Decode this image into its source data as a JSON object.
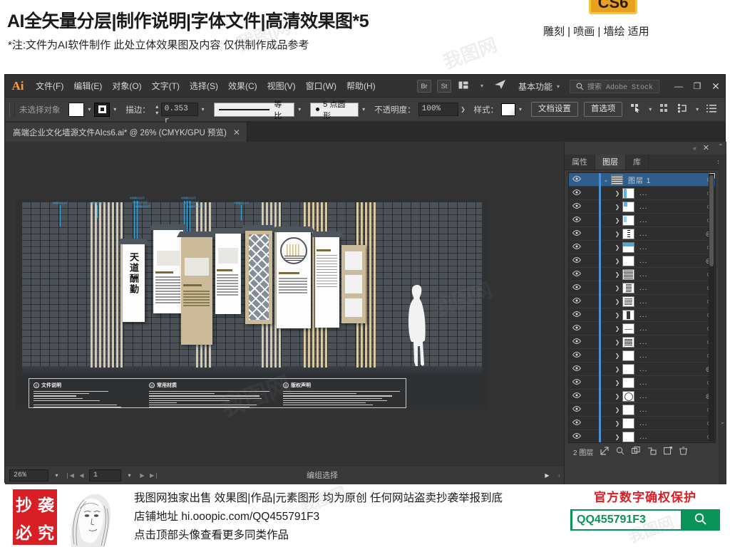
{
  "promo": {
    "title": "AI全矢量分层|制作说明|字体文件|高清效果图*5",
    "subtitle": "*注:文件为AI软件制作 此处立体效果图及内容 仅供制作成品参考",
    "right_text": "雕刻 | 喷画 | 墙绘 适用",
    "badge": "CS6",
    "badge_bg": "#e8a020",
    "badge_border": "#f5c53a"
  },
  "app": {
    "logo": "Ai",
    "menus": [
      "文件(F)",
      "编辑(E)",
      "对象(O)",
      "文字(T)",
      "选择(S)",
      "效果(C)",
      "视图(V)",
      "窗口(W)",
      "帮助(H)"
    ],
    "bridge_button": "Br",
    "stock_button": "St",
    "workspace": "基本功能",
    "stock_search_placeholder": "搜索 Adobe Stock",
    "window_buttons": {
      "minimize": "—",
      "maximize": "❐",
      "close": "✕"
    }
  },
  "control_bar": {
    "selection_status": "未选择对象",
    "stroke_label": "描边：",
    "stroke_weight": "0.353 r",
    "profile_label": "等比",
    "brush_label": "5 点圆形",
    "opacity_label": "不透明度：",
    "opacity_value": "100%",
    "style_label": "样式：",
    "doc_setup_button": "文档设置",
    "preferences_button": "首选项"
  },
  "document_tab": {
    "title": "高端企业文化墙源文件AIcs6.ai* @ 26% (CMYK/GPU 预览)",
    "close_glyph": "✕"
  },
  "status_bar": {
    "zoom": "26%",
    "page": "1",
    "tool": "编组选择",
    "first_glyph": "❘◀",
    "prev_glyph": "◀",
    "next_glyph": "▶",
    "last_glyph": "▶❘",
    "play_glyph": "▶",
    "expand_glyph": "‹"
  },
  "panel_dock": {
    "collapse_glyph": "«",
    "close_glyph": "✕",
    "tabs": [
      {
        "label": "属性",
        "active": false
      },
      {
        "label": "图层",
        "active": true
      },
      {
        "label": "库",
        "active": false
      }
    ],
    "menu_glyph": "≡",
    "footer": {
      "count_label": "2 图层",
      "icons": [
        "locate-icon",
        "search-icon",
        "new-sublayer-icon",
        "release-icon",
        "new-layer-icon",
        "trash-icon"
      ]
    },
    "layers": [
      {
        "name": "图层 1",
        "selected": true,
        "expanded": true,
        "thumb": "wall",
        "target": "○"
      },
      {
        "name": "...",
        "selected": false,
        "expanded": false,
        "thumb": "panel1",
        "target": "○"
      },
      {
        "name": "...",
        "selected": false,
        "expanded": false,
        "thumb": "panel2",
        "target": "○"
      },
      {
        "name": "...",
        "selected": false,
        "expanded": false,
        "thumb": "panel3",
        "target": "○"
      },
      {
        "name": "...",
        "selected": false,
        "expanded": false,
        "thumb": "calli",
        "target": "◎"
      },
      {
        "name": "...",
        "selected": false,
        "expanded": false,
        "thumb": "panel4",
        "target": "○"
      },
      {
        "name": "...",
        "selected": false,
        "expanded": false,
        "thumb": "blank",
        "target": "◎"
      },
      {
        "name": "...",
        "selected": false,
        "expanded": false,
        "thumb": "text1",
        "target": "○"
      },
      {
        "name": "...",
        "selected": false,
        "expanded": false,
        "thumb": "text2",
        "target": "○"
      },
      {
        "name": "...",
        "selected": false,
        "expanded": false,
        "thumb": "text3",
        "target": "○"
      },
      {
        "name": "...",
        "selected": false,
        "expanded": false,
        "thumb": "bar",
        "target": "○"
      },
      {
        "name": "...",
        "selected": false,
        "expanded": false,
        "thumb": "dash",
        "target": "○"
      },
      {
        "name": "...",
        "selected": false,
        "expanded": false,
        "thumb": "text4",
        "target": "○"
      },
      {
        "name": "...",
        "selected": false,
        "expanded": false,
        "thumb": "blank",
        "target": "○"
      },
      {
        "name": "...",
        "selected": false,
        "expanded": false,
        "thumb": "blank",
        "target": "◎"
      },
      {
        "name": "...",
        "selected": false,
        "expanded": false,
        "thumb": "blank",
        "target": "○"
      },
      {
        "name": "...",
        "selected": false,
        "expanded": false,
        "thumb": "circle",
        "target": "◎"
      },
      {
        "name": "...",
        "selected": false,
        "expanded": false,
        "thumb": "blank",
        "target": "○"
      },
      {
        "name": "...",
        "selected": false,
        "expanded": false,
        "thumb": "blank",
        "target": "○"
      },
      {
        "name": "...",
        "selected": false,
        "expanded": false,
        "thumb": "blank",
        "target": "○"
      }
    ]
  },
  "artwork": {
    "info_sections": [
      {
        "badge": "文",
        "title": "文件说明"
      },
      {
        "badge": "材",
        "title": "常用材质"
      },
      {
        "badge": "版",
        "title": "版权声明"
      }
    ],
    "calligraphy": "天道酬勤",
    "callout_note": "效果图标注文字",
    "accent_wood": "#cdbb92",
    "accent_brick": "#4b5157"
  },
  "footer": {
    "stamp": [
      "抄",
      "袭",
      "必",
      "究"
    ],
    "lines": [
      "我图网独家出售 效果图|作品|元素图形 均为原创 任何网站盗卖抄袭举报到底",
      "店铺地址 hi.ooopic.com/QQ455791F3",
      "点击顶部头像查看更多同类作品"
    ],
    "right_title": "官方数字确权保护",
    "right_value": "QQ455791F3",
    "right_brand_color": "#0a9359",
    "right_title_color": "#d81f26"
  }
}
